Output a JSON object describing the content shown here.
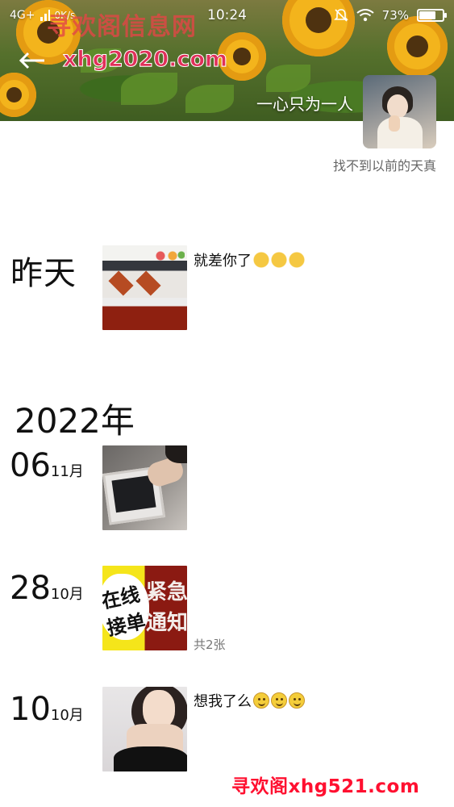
{
  "status_bar": {
    "network": "4G+",
    "speed": "0K/s",
    "time": "10:24",
    "battery": "73%",
    "battery_level": 0.73
  },
  "watermarks": {
    "top_site_name": "寻欢阁信息网",
    "top_url": "xhg2020.com",
    "bottom": "寻欢阁xhg521.com"
  },
  "profile": {
    "nickname": "一心只为一人",
    "signature": "找不到以前的天真"
  },
  "feed": {
    "yesterday_label": "昨天",
    "yesterday_post_text": "就差你了",
    "year_label": "2022年",
    "posts": [
      {
        "day": "06",
        "month": "11月",
        "text": "",
        "count": ""
      },
      {
        "day": "28",
        "month": "10月",
        "text": "",
        "count": "共2张"
      },
      {
        "day": "10",
        "month": "10月",
        "text": "想我了么",
        "count": ""
      }
    ]
  },
  "notice_image_text": {
    "left": "在线接单",
    "right": "紧急通知"
  },
  "icons": {
    "back": "back-arrow-icon",
    "signal": "signal-icon",
    "mute": "bell-mute-icon",
    "wifi": "wifi-icon",
    "battery": "battery-icon",
    "victory_emoji": "victory-hand-emoji",
    "smile_emoji": "smile-emoji"
  }
}
